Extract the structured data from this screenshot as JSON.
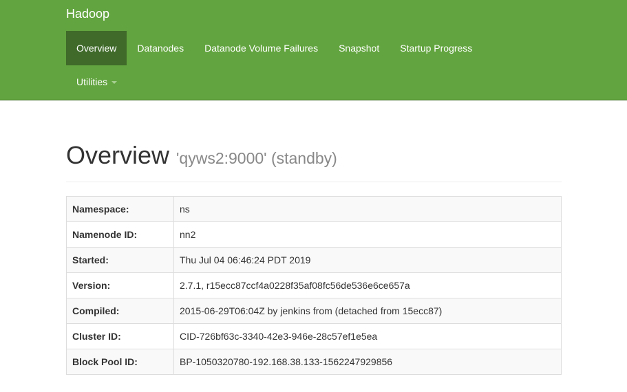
{
  "header": {
    "brand": "Hadoop",
    "nav": [
      {
        "label": "Overview",
        "active": true
      },
      {
        "label": "Datanodes"
      },
      {
        "label": "Datanode Volume Failures"
      },
      {
        "label": "Snapshot"
      },
      {
        "label": "Startup Progress"
      }
    ],
    "utilities_label": "Utilities"
  },
  "page": {
    "title": "Overview",
    "subtitle": "'qyws2:9000' (standby)"
  },
  "info": [
    {
      "label": "Namespace:",
      "value": "ns"
    },
    {
      "label": "Namenode ID:",
      "value": "nn2"
    },
    {
      "label": "Started:",
      "value": "Thu Jul 04 06:46:24 PDT 2019"
    },
    {
      "label": "Version:",
      "value": "2.7.1, r15ecc87ccf4a0228f35af08fc56de536e6ce657a"
    },
    {
      "label": "Compiled:",
      "value": "2015-06-29T06:04Z by jenkins from (detached from 15ecc87)"
    },
    {
      "label": "Cluster ID:",
      "value": "CID-726bf63c-3340-42e3-946e-28c57ef1e5ea"
    },
    {
      "label": "Block Pool ID:",
      "value": "BP-1050320780-192.168.38.133-1562247929856"
    }
  ],
  "colors": {
    "navbar": "#62a43f",
    "nav_active": "#3f6a2a"
  }
}
